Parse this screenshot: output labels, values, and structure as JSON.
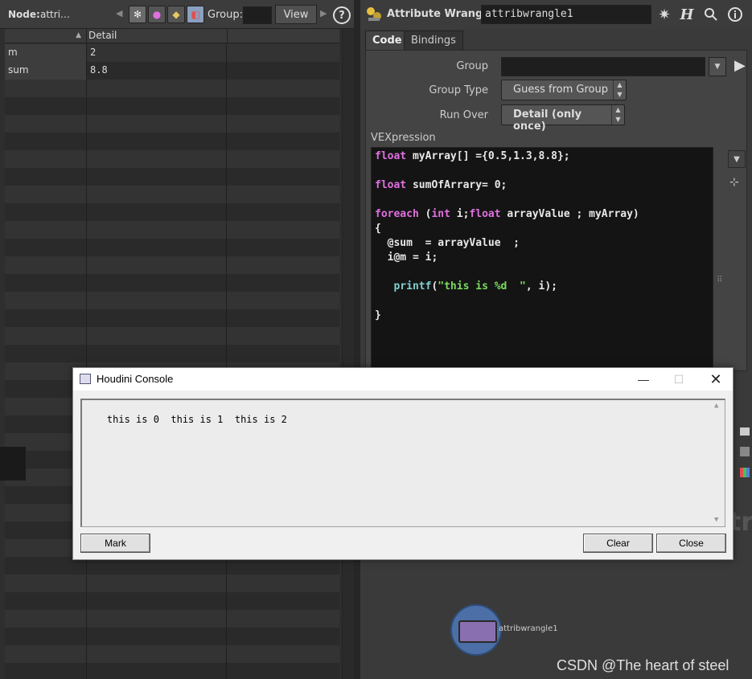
{
  "left_pane": {
    "node_label": "Node:",
    "node_value": "attri…",
    "group_label": "Group:",
    "view_label": "View",
    "help_label": "?",
    "column_header": "Detail",
    "rows": [
      {
        "name": "m",
        "value": "2"
      },
      {
        "name": "sum",
        "value": "8.8"
      }
    ]
  },
  "right_pane": {
    "node_type": "Attribute Wrangle",
    "node_name": "attribwrangle1",
    "tabs": [
      "Code",
      "Bindings"
    ],
    "params": {
      "group_label": "Group",
      "group_value": "",
      "group_type_label": "Group Type",
      "group_type_value": "Guess from Group",
      "run_over_label": "Run Over",
      "run_over_value": "Detail (only once)",
      "vex_label": "VEXpression"
    },
    "code_lines": [
      "float myArray[] ={0.5,1.3,8.8};",
      "",
      "float sumOfArrary= 0;",
      "",
      "foreach (int i;float arrayValue ; myArray)",
      "{",
      "  @sum  = arrayValue  ;",
      "  i@m = i;",
      "",
      "   printf(\"this is %d  \", i);",
      "",
      "}"
    ]
  },
  "network": {
    "node_label": "attribwrangle1",
    "watermark": "CSDN @The heart of steel"
  },
  "console": {
    "title": "Houdini Console",
    "output": "this is 0  this is 1  this is 2",
    "mark_label": "Mark",
    "clear_label": "Clear",
    "close_label": "Close"
  },
  "colors": {
    "keyword": "#e070e0",
    "function": "#7fd0d0",
    "string": "#7cdc60",
    "node_blue": "#4b6fa6"
  }
}
